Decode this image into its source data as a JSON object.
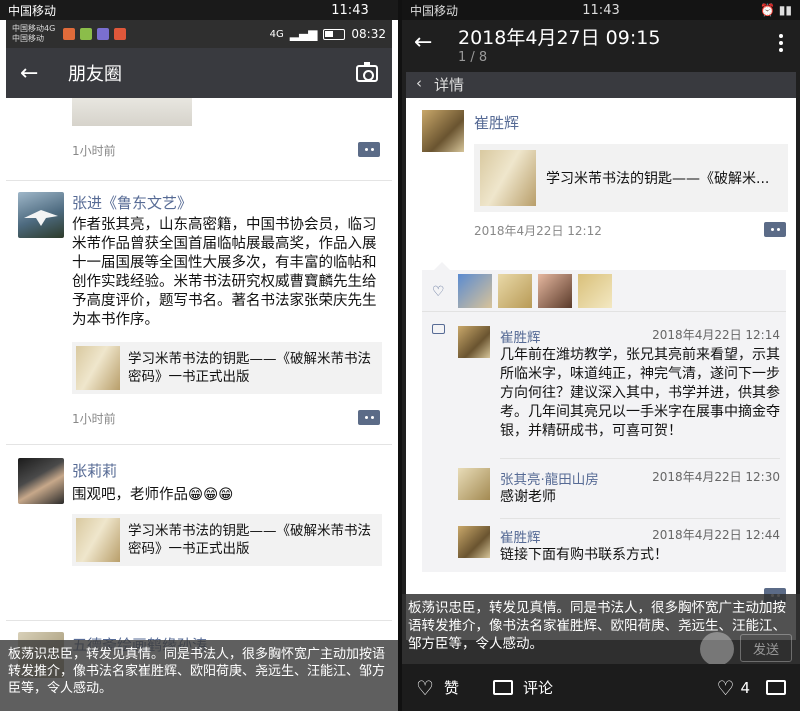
{
  "left": {
    "status": {
      "carrier": "中国移动",
      "time": "11:43"
    },
    "inner_status": {
      "line1": "中国移动4G",
      "line2": "中国移动",
      "network": "4G",
      "time": "08:32"
    },
    "title": "朋友圈",
    "top_post": {
      "time": "1小时前"
    },
    "post1": {
      "author": "张进《鲁东文艺》",
      "text": "作者张其亮，山东高密籍，中国书协会员，临习米芾作品曾获全国首届临帖展最高奖，作品入展十一届国展等全国性大展多次，有丰富的临帖和创作实践经验。米芾书法研究权威曹寶麟先生给予高度评价，题写书名。著名书法家张荣庆先生为本书作序。",
      "link": "学习米芾书法的钥匙——《破解米芾书法密码》一书正式出版",
      "time": "1小时前"
    },
    "post2": {
      "author": "张莉莉",
      "text": "围观吧，老师作品😁😁😁",
      "link": "学习米芾书法的钥匙——《破解米芾书法密码》一书正式出版"
    },
    "post3": {
      "author": "五德斋绘画鹤缘孙涛"
    },
    "overlay_text": "板荡识忠臣，转发见真情。同是书法人，很多胸怀宽广主动加按语转发推介，像书法名家崔胜辉、欧阳荷庚、尧远生、汪能江、邹方臣等，令人感动。"
  },
  "right": {
    "status": {
      "carrier": "中国移动",
      "time": "11:43"
    },
    "header": {
      "date": "2018年4月27日 09:15",
      "page": "1 / 8"
    },
    "section_label": "详情",
    "post": {
      "author": "崔胜辉",
      "link": "学习米芾书法的钥匙——《破解米...",
      "time": "2018年4月22日 12:12"
    },
    "comments": [
      {
        "name": "崔胜辉",
        "time": "2018年4月22日 12:14",
        "text": "几年前在潍坊教学，张兄其亮前来看望，示其所临米字，味道纯正，神完气清，遂问下一步方向何往？建议深入其中，书学并进，供其参考。几年间其亮兄以一手米字在展事中摘金夺银，并精研成书，可喜可贺！"
      },
      {
        "name": "张其亮·龍田山房",
        "time": "2018年4月22日 12:30",
        "text": "感谢老师"
      },
      {
        "name": "崔胜辉",
        "time": "2018年4月22日 12:44",
        "text": "链接下面有购书联系方式！"
      }
    ],
    "overlay_text": "板荡识忠臣，转发见真情。同是书法人，很多胸怀宽广主动加按语转发推介，像书法名家崔胜辉、欧阳荷庚、尧远生、汪能江、邹方臣等，令人感动。",
    "send_label": "发送",
    "bottom": {
      "like": "赞",
      "comment": "评论",
      "like_count": "4"
    }
  },
  "colors": {
    "link_blue": "#576b95",
    "appbar": "#393a3f"
  }
}
